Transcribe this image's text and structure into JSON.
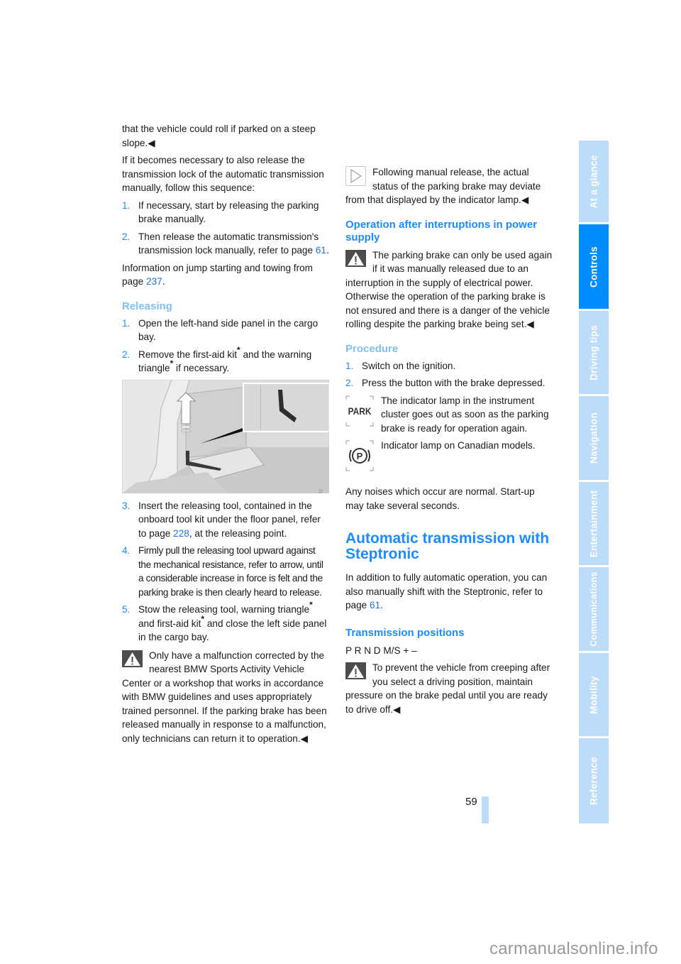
{
  "left_column": {
    "intro_text": "that the vehicle could roll if parked on a steep slope.",
    "end_marker": "◀",
    "transmission_lock_intro": "If it becomes necessary to also release the transmission lock of the automatic transmission manually, follow this sequence:",
    "sequence_steps": [
      {
        "num": "1.",
        "text": "If necessary, start by releasing the parking brake manually."
      },
      {
        "num": "2.",
        "text_before": "Then release the automatic transmission's transmission lock manually, refer to page ",
        "link": "61",
        "text_after": "."
      }
    ],
    "jump_start": {
      "text_before": "Information on jump starting and towing from page ",
      "link": "237",
      "text_after": "."
    },
    "releasing_heading": "Releasing",
    "releasing_steps_a": [
      {
        "num": "1.",
        "text": "Open the left-hand side panel in the cargo bay."
      },
      {
        "num": "2.",
        "text_a": "Remove the first-aid kit",
        "star": "*",
        "text_b": " and the warning triangle",
        "text_c": " if necessary."
      }
    ],
    "figure_code": "W0EG9FUU",
    "releasing_steps_b": [
      {
        "num": "3.",
        "text_before": "Insert the releasing tool, contained in the onboard tool kit under the floor panel, refer to page ",
        "link": "228",
        "text_after": ", at the releasing point."
      },
      {
        "num": "4.",
        "text": "Firmly pull the releasing tool upward against the mechanical resistance, refer to arrow, until a considerable increase in force is felt and the parking brake is then clearly heard to release."
      },
      {
        "num": "5.",
        "text_a": "Stow the releasing tool, warning triangle",
        "text_b": " and first-aid kit",
        "text_c": " and close the left side panel in the cargo bay."
      }
    ],
    "warning_malfunction": "Only have a malfunction corrected by the nearest BMW Sports Activity Vehicle Center or a workshop that works in accordance with BMW guidelines and uses appropriately trained personnel. If the parking brake has been released manually in response to a malfunction, only technicians can return it to operation."
  },
  "right_column": {
    "note_manual_release": "Following manual release, the actual status of the parking brake may deviate from that displayed by the indicator lamp.",
    "power_heading": "Operation after interruptions in power supply",
    "warning_power": "The parking brake can only be used again if it was manually released due to an interruption in the supply of electrical power. Otherwise the operation of the parking brake is not ensured and there is a danger of the vehicle rolling despite the parking brake being set.",
    "procedure_heading": "Procedure",
    "procedure_steps": [
      {
        "num": "1.",
        "text": "Switch on the ignition."
      },
      {
        "num": "2.",
        "text": "Press the button with the brake depressed."
      }
    ],
    "lamp_park_label": "PARK",
    "lamp_park_text": "The indicator lamp in the instrument cluster goes out as soon as the parking brake is ready for operation again.",
    "lamp_canada_label": "(P)",
    "lamp_canada_text": "Indicator lamp on Canadian models.",
    "noises_text": "Any noises which occur are normal. Start-up may take several seconds.",
    "steptronic_heading": "Automatic transmission with Steptronic",
    "steptronic_text": {
      "text_before": "In addition to fully automatic operation, you can also manually shift with the Steptronic, refer to page ",
      "link": "61",
      "text_after": "."
    },
    "positions_heading": "Transmission positions",
    "positions_text": "P R N D M/S + –",
    "warning_creeping": "To prevent the vehicle from creeping after you select a driving position, maintain pressure on the brake pedal until you are ready to drive off."
  },
  "sidebar": {
    "tabs": [
      {
        "label": "At a glance",
        "active": false
      },
      {
        "label": "Controls",
        "active": true
      },
      {
        "label": "Driving tips",
        "active": false
      },
      {
        "label": "Navigation",
        "active": false
      },
      {
        "label": "Entertainment",
        "active": false
      },
      {
        "label": "Communications",
        "active": false
      },
      {
        "label": "Mobility",
        "active": false
      },
      {
        "label": "Reference",
        "active": false
      }
    ],
    "active_color": "#008cff",
    "inactive_color": "#bcdcfa"
  },
  "footer": {
    "page_number": "59",
    "watermark": "carmanualsonline.info"
  }
}
